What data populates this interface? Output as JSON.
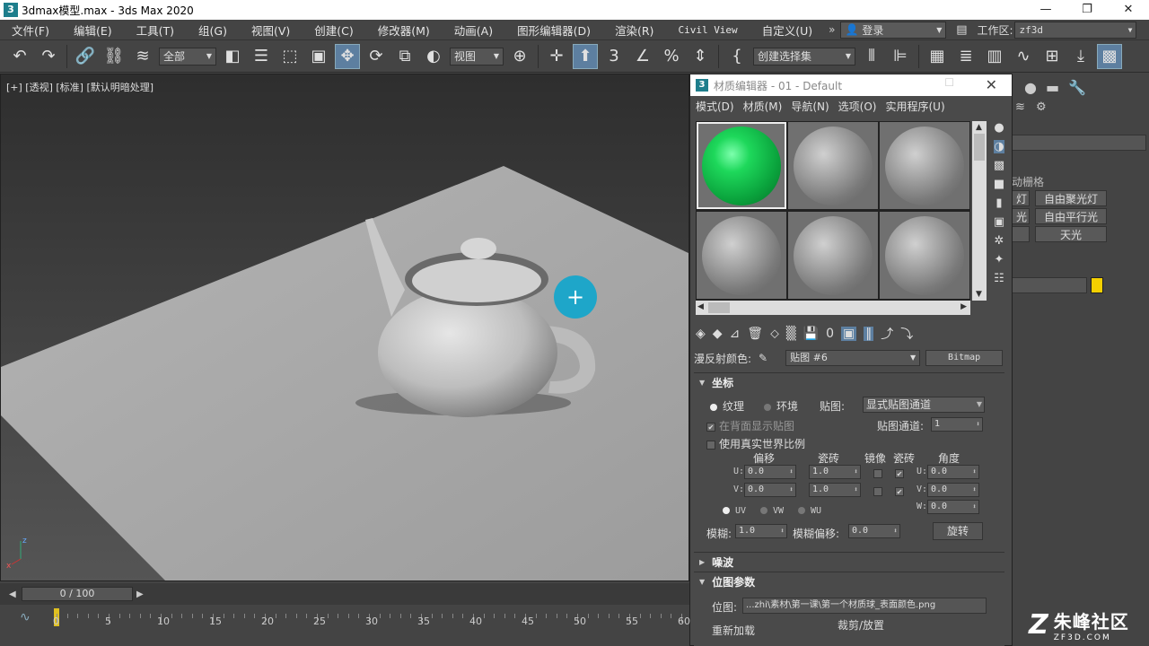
{
  "titlebar": {
    "icon": "3",
    "title": "3dmax模型.max - 3ds Max 2020",
    "min": "—",
    "restore": "❐",
    "close": "✕"
  },
  "menubar": {
    "items": [
      "文件(F)",
      "编辑(E)",
      "工具(T)",
      "组(G)",
      "视图(V)",
      "创建(C)",
      "修改器(M)",
      "动画(A)",
      "图形编辑器(D)",
      "渲染(R)",
      "Civil View",
      "自定义(U)"
    ],
    "more": "»",
    "login": "登录",
    "workspace_label": "工作区:",
    "workspace_value": "zf3d"
  },
  "toolbar": {
    "selection_filter": "全部",
    "ref_coord": "视图",
    "selection_set": "创建选择集"
  },
  "viewport": {
    "label": "[+] [透视] [标准] [默认明暗处理]",
    "axis_x": "x",
    "axis_z": "z"
  },
  "material_editor": {
    "icon": "3",
    "title": "材质编辑器 - 01 - Default",
    "menu": [
      "模式(D)",
      "材质(M)",
      "导航(N)",
      "选项(O)",
      "实用程序(U)"
    ],
    "slots": [
      {
        "color": "green",
        "selected": true
      },
      {
        "color": "gray",
        "selected": false
      },
      {
        "color": "gray",
        "selected": false
      },
      {
        "color": "gray",
        "selected": false
      },
      {
        "color": "gray",
        "selected": false
      },
      {
        "color": "gray",
        "selected": false
      }
    ],
    "diffuse_label": "漫反射颜色:",
    "map_name": "贴图 #6",
    "map_type": "Bitmap",
    "coordinates": {
      "header": "坐标",
      "texture": "纹理",
      "environ": "环境",
      "mapping_label": "贴图:",
      "mapping_value": "显式贴图通道",
      "show_map_back": "在背面显示贴图",
      "channel_label": "贴图通道:",
      "channel_value": "1",
      "real_world": "使用真实世界比例",
      "offset": "偏移",
      "tiling": "瓷砖",
      "mirror": "镜像",
      "tile": "瓷砖",
      "angle": "角度",
      "u_label": "U:",
      "v_label": "V:",
      "w_label": "W:",
      "u_offset": "0.0",
      "v_offset": "0.0",
      "u_tiling": "1.0",
      "v_tiling": "1.0",
      "u_angle": "0.0",
      "v_angle": "0.0",
      "w_angle": "0.0",
      "uv": "UV",
      "vw": "VW",
      "wu": "WU",
      "blur_label": "模糊:",
      "blur_value": "1.0",
      "blur_offset_label": "模糊偏移:",
      "blur_offset_value": "0.0",
      "rotate": "旋转"
    },
    "noise": {
      "header": "噪波"
    },
    "bitmap": {
      "header": "位图参数",
      "path_label": "位图:",
      "path_value": "...zhi\\素材\\第一课\\第一个材质球_表面颜色.png",
      "reload": "重新加载",
      "crop": "裁剪/放置"
    }
  },
  "command_panel": {
    "list_label": "动栅格",
    "lights": [
      "灯",
      "自由聚光灯",
      "光",
      "自由平行光",
      "天光"
    ],
    "swatch_color": "#f5d000"
  },
  "timeline": {
    "frame": "0 / 100",
    "ticks": [
      "0",
      "5",
      "10",
      "15",
      "20",
      "25",
      "30",
      "35",
      "40",
      "45",
      "50",
      "55",
      "60"
    ]
  },
  "watermark": {
    "logo": "Z",
    "name": "朱峰社区",
    "url": "ZF3D.COM"
  }
}
